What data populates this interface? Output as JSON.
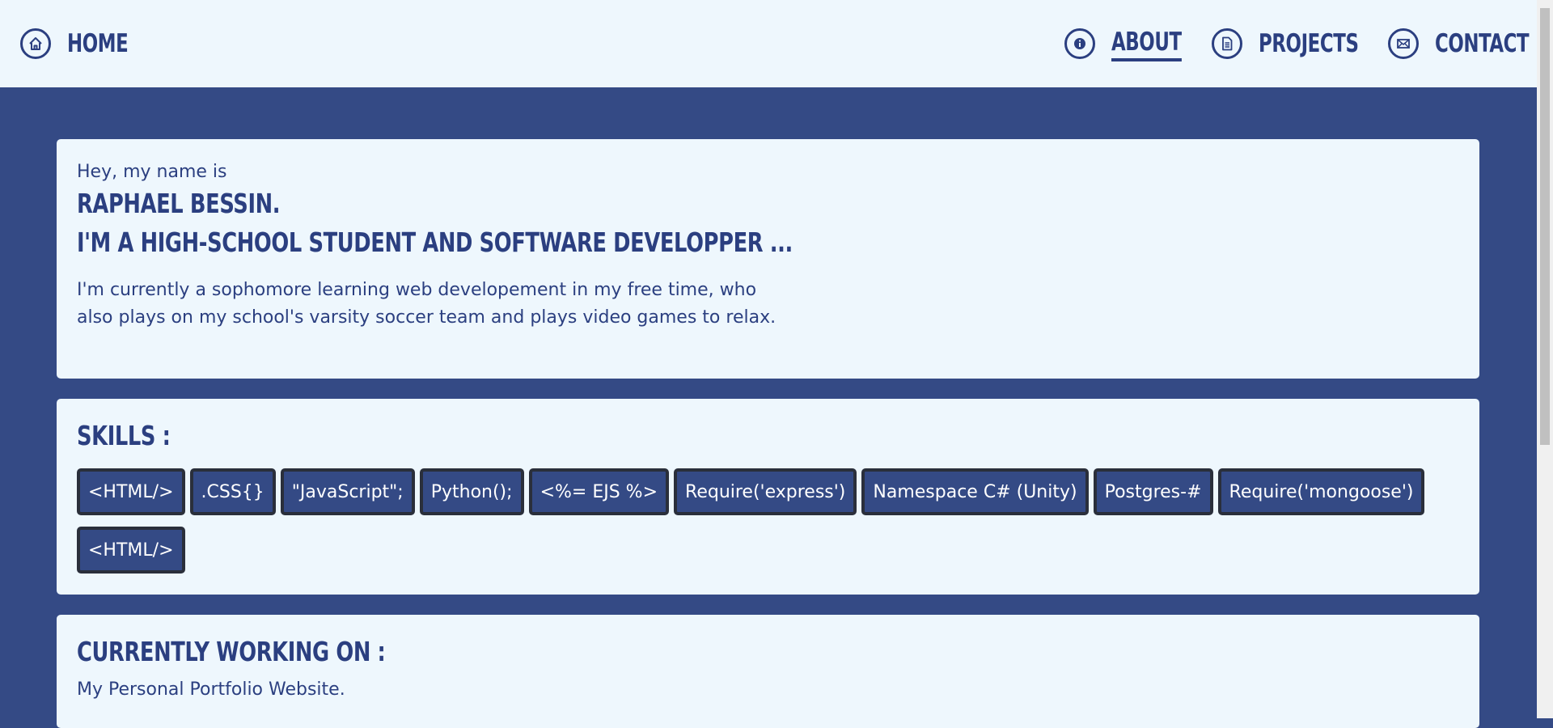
{
  "nav": {
    "home": {
      "label": "HOME",
      "icon": "home-icon"
    },
    "about": {
      "label": "ABOUT",
      "icon": "info-icon"
    },
    "projects": {
      "label": "PROJECTS",
      "icon": "document-icon"
    },
    "contact": {
      "label": "CONTACT",
      "icon": "mail-icon"
    },
    "active": "about"
  },
  "intro": {
    "greeting": "Hey, my name is",
    "name": "RAPHAEL BESSIN.",
    "role": "I'M A HIGH-SCHOOL STUDENT AND SOFTWARE DEVELOPPER ...",
    "bio": "I'm currently a sophomore learning web developement in my free time, who also plays on my school's varsity soccer team and plays video games to relax."
  },
  "skills": {
    "title": "SKILLS :",
    "items": [
      "<HTML/>",
      ".CSS{}",
      "\"JavaScript\";",
      "Python();",
      "<%= EJS %>",
      "Require('express')",
      "Namespace C# (Unity)",
      "Postgres-#",
      "Require('mongoose')",
      "<HTML/>"
    ]
  },
  "working_on": {
    "title": "CURRENTLY WORKING ON :",
    "text": "My Personal Portfolio Website."
  },
  "colors": {
    "background": "#344a85",
    "card": "#eef7fd",
    "text": "#2b3f80",
    "skill_bg": "#344a85",
    "skill_border": "#2a2f3b"
  }
}
